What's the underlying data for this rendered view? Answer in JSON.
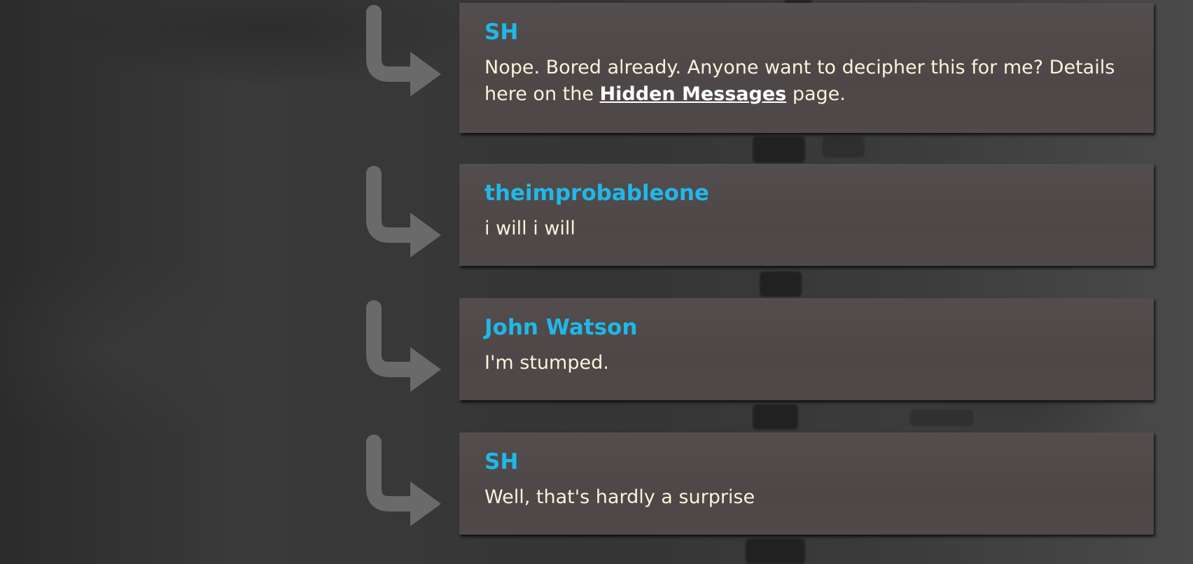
{
  "comments": [
    {
      "author": "SH",
      "text_before_link": "Nope. Bored already. Anyone want to decipher this for me? Details here on the ",
      "link_label": "Hidden Messages",
      "text_after_link": " page."
    },
    {
      "author": "theimprobableone",
      "text": "i will i will"
    },
    {
      "author": "John Watson",
      "text": "I'm stumped."
    },
    {
      "author": "SH",
      "text": "Well, that's hardly a surprise"
    }
  ],
  "icons": {
    "reply": "reply-arrow-icon"
  },
  "colors": {
    "author": "#1fb8e8",
    "text": "#f6f4dc",
    "box": "#4f4949",
    "arrow": "#6a6a6a"
  }
}
